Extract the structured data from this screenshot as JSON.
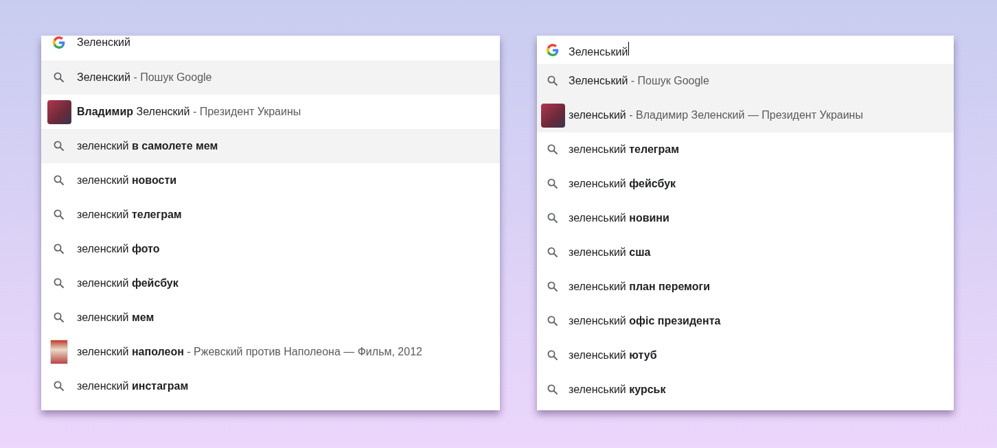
{
  "panels": [
    {
      "query": "Зеленский",
      "caret": false,
      "suggestions": [
        {
          "kind": "search",
          "text": "Зеленский",
          "detail": "- Пошук Google",
          "selected": true
        },
        {
          "kind": "person",
          "text": "**Владимир** Зеленский",
          "detail": "- Президент Украины",
          "selected": false
        },
        {
          "kind": "search",
          "text": "зеленский **в самолете мем**",
          "selected": true
        },
        {
          "kind": "search",
          "text": "зеленский **новости**",
          "selected": false
        },
        {
          "kind": "search",
          "text": "зеленский **телеграм**",
          "selected": false
        },
        {
          "kind": "search",
          "text": "зеленский **фото**",
          "selected": false
        },
        {
          "kind": "search",
          "text": "зеленский **фейсбук**",
          "selected": false
        },
        {
          "kind": "search",
          "text": "зеленский **мем**",
          "selected": false
        },
        {
          "kind": "poster",
          "text": "зеленский **наполеон**",
          "detail": "- Ржевский против Наполеона — Фильм, 2012",
          "selected": false
        },
        {
          "kind": "search",
          "text": "зеленский **инстаграм**",
          "selected": false
        }
      ]
    },
    {
      "query": "Зеленський",
      "caret": true,
      "suggestions": [
        {
          "kind": "search",
          "text": "Зеленський",
          "detail": "- Пошук Google",
          "selected": true
        },
        {
          "kind": "person",
          "text": "зеленський",
          "detail": "- Владимир Зеленский — Президент Украины",
          "selected": true
        },
        {
          "kind": "search",
          "text": "зеленський **телеграм**",
          "selected": false
        },
        {
          "kind": "search",
          "text": "зеленський **фейсбук**",
          "selected": false
        },
        {
          "kind": "search",
          "text": "зеленський **новини**",
          "selected": false
        },
        {
          "kind": "search",
          "text": "зеленський **сша**",
          "selected": false
        },
        {
          "kind": "search",
          "text": "зеленський **план перемоги**",
          "selected": false
        },
        {
          "kind": "search",
          "text": "зеленський **офіс президента**",
          "selected": false
        },
        {
          "kind": "search",
          "text": "зеленський **ютуб**",
          "selected": false
        },
        {
          "kind": "search",
          "text": "зеленський **курськ**",
          "selected": false
        }
      ]
    }
  ]
}
